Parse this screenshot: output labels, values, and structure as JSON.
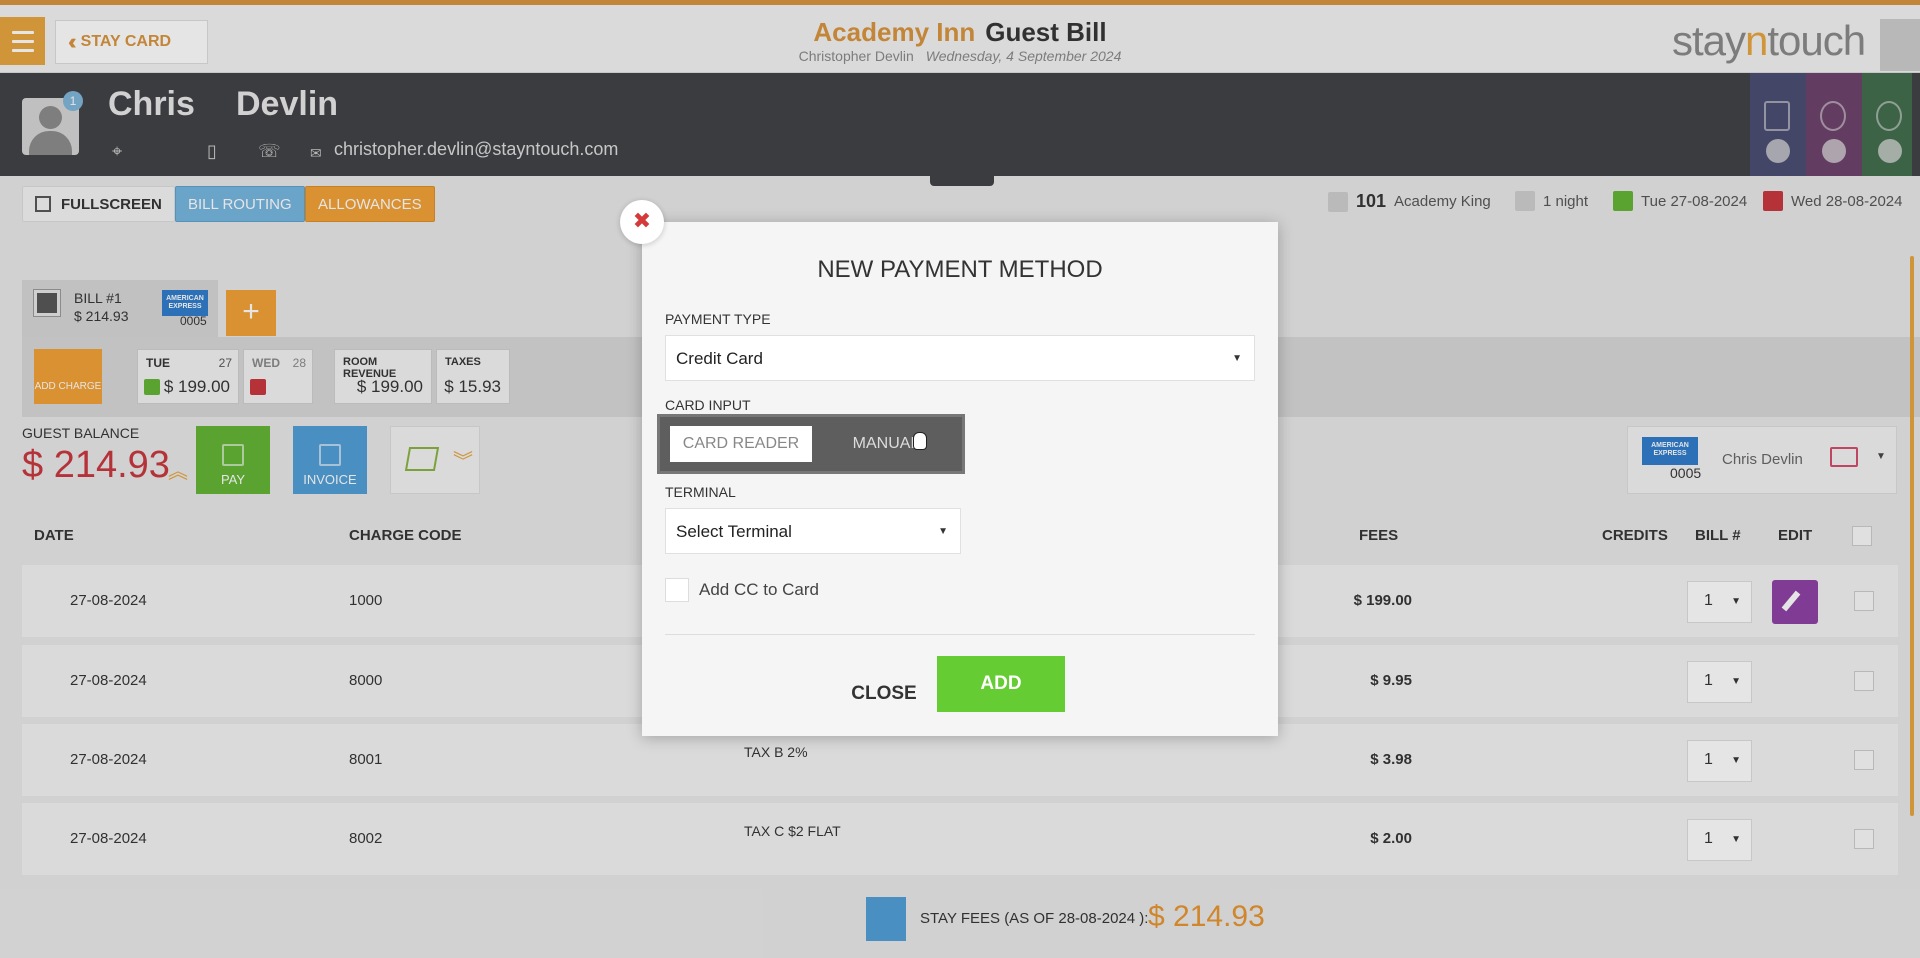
{
  "topbar": {
    "stay_card_label": "STAY CARD",
    "hotel_name": "Academy Inn",
    "page_title": "Guest Bill",
    "guest_full_name": "Christopher Devlin",
    "date": "Wednesday, 4 September 2024",
    "brand_pre": "stay",
    "brand_mid": "n",
    "brand_post": "touch"
  },
  "guest": {
    "first_name": "Chris",
    "last_name": "Devlin",
    "badge_count": "1",
    "email": "christopher.devlin@stayntouch.com"
  },
  "toolbar": {
    "fullscreen": "FULLSCREEN",
    "bill_routing": "BILL ROUTING",
    "allowances": "ALLOWANCES"
  },
  "stay": {
    "room_number": "101",
    "room_type": "Academy King",
    "nights": "1 night",
    "arrival": "Tue 27-08-2024",
    "departure": "Wed 28-08-2024"
  },
  "bill": {
    "label": "BILL #1",
    "amount": "$ 214.93",
    "card_brand": "AMERICAN EXPRESS",
    "card_last4": "0005",
    "add_charge": "ADD CHARGE",
    "days": [
      {
        "name": "TUE",
        "date": "27",
        "value": "$ 199.00"
      },
      {
        "name": "WED",
        "date": "28",
        "value": ""
      }
    ],
    "room_revenue_label": "ROOM REVENUE",
    "room_revenue": "$ 199.00",
    "taxes_label": "TAXES",
    "taxes": "$ 15.93",
    "guest_balance_label": "GUEST BALANCE",
    "guest_balance": "$ 214.93",
    "pay": "PAY",
    "invoice": "INVOICE",
    "card_holder": "Chris Devlin"
  },
  "table": {
    "headers": {
      "date": "DATE",
      "charge_code": "CHARGE CODE",
      "fees": "FEES",
      "credits": "CREDITS",
      "bill": "BILL #",
      "edit": "EDIT"
    },
    "rows": [
      {
        "date": "27-08-2024",
        "code": "1000",
        "desc": "",
        "fee": "$ 199.00",
        "bill": "1"
      },
      {
        "date": "27-08-2024",
        "code": "8000",
        "desc": "",
        "fee": "$ 9.95",
        "bill": "1"
      },
      {
        "date": "27-08-2024",
        "code": "8001",
        "desc": "TAX B 2%",
        "fee": "$ 3.98",
        "bill": "1"
      },
      {
        "date": "27-08-2024",
        "code": "8002",
        "desc": "TAX C $2 FLAT",
        "fee": "$ 2.00",
        "bill": "1"
      }
    ],
    "footer_label": "STAY FEES (AS OF  28-08-2024 ):",
    "footer_amount": "$ 214.93"
  },
  "modal": {
    "title": "NEW PAYMENT METHOD",
    "payment_type_label": "PAYMENT TYPE",
    "payment_type_value": "Credit Card",
    "card_input_label": "CARD INPUT",
    "card_reader": "CARD READER",
    "manual": "MANUAL",
    "terminal_label": "TERMINAL",
    "terminal_value": "Select Terminal",
    "add_cc_label": "Add CC to Card",
    "close": "CLOSE",
    "add": "ADD",
    "close_x": "✖"
  },
  "colors": {
    "accent": "#e8a33c",
    "header_dark": "#3e3f43",
    "balance_red": "#c9343c",
    "add_green": "#66cc33"
  }
}
